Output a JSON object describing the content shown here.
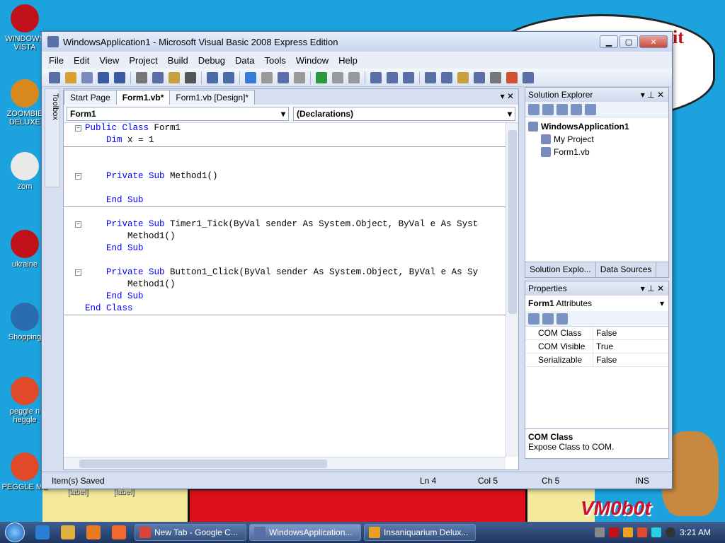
{
  "desktop": {
    "icons": [
      {
        "label": "WINDOWS VISTA",
        "color": "#c0101a"
      },
      {
        "label": "ZOOMBIE DELUXE",
        "color": "#d88a20"
      },
      {
        "label": "zom",
        "color": "#e9e9e9"
      },
      {
        "label": "ukraine",
        "color": "#c0101a"
      },
      {
        "label": "Shopping",
        "color": "#2b6cb0"
      },
      {
        "label": "peggle n heggle",
        "color": "#e04a2a"
      },
      {
        "label": "PEGGLE ME",
        "color": "#e04a2a"
      }
    ],
    "overlay_label_a": "[label]",
    "overlay_label_b": "[label]",
    "bubble_text": "it",
    "watermark": "VM0b0t"
  },
  "window": {
    "title": "WindowsApplication1 - Microsoft Visual Basic 2008 Express Edition",
    "min_label": "▁",
    "max_label": "▢",
    "close_label": "✕"
  },
  "menu": [
    "File",
    "Edit",
    "View",
    "Project",
    "Build",
    "Debug",
    "Data",
    "Tools",
    "Window",
    "Help"
  ],
  "toolbox_label": "Toolbox",
  "editor": {
    "tabs": [
      "Start Page",
      "Form1.vb*",
      "Form1.vb [Design]*"
    ],
    "active_tab": 1,
    "tab_ctrls": "▾  ✕",
    "class_combo": "Form1",
    "member_combo": "(Declarations)",
    "lines": [
      {
        "fold": "−",
        "kw": "Public Class",
        "text": " Form1",
        "sep": false
      },
      {
        "fold": "",
        "kw": "    Dim",
        "text": " x = 1",
        "sep": true
      },
      {
        "fold": "",
        "kw": "",
        "text": "",
        "sep": false
      },
      {
        "fold": "",
        "kw": "",
        "text": "",
        "sep": false
      },
      {
        "fold": "−",
        "kw": "    Private Sub",
        "text": " Method1()",
        "sep": false
      },
      {
        "fold": "",
        "kw": "",
        "text": "",
        "sep": false
      },
      {
        "fold": "",
        "kw": "    End Sub",
        "text": "",
        "sep": true
      },
      {
        "fold": "",
        "kw": "",
        "text": "",
        "sep": false
      },
      {
        "fold": "−",
        "kw": "    Private Sub",
        "text": " Timer1_Tick(ByVal sender As System.Object, ByVal e As Syst",
        "sep": false
      },
      {
        "fold": "",
        "kw": "",
        "text": "        Method1()",
        "sep": false
      },
      {
        "fold": "",
        "kw": "    End Sub",
        "text": "",
        "sep": false
      },
      {
        "fold": "",
        "kw": "",
        "text": "",
        "sep": false
      },
      {
        "fold": "−",
        "kw": "    Private Sub",
        "text": " Button1_Click(ByVal sender As System.Object, ByVal e As Sy",
        "sep": false
      },
      {
        "fold": "",
        "kw": "",
        "text": "        Method1()",
        "sep": false
      },
      {
        "fold": "",
        "kw": "    End Sub",
        "text": "",
        "sep": false
      },
      {
        "fold": "",
        "kw": "End Class",
        "text": "",
        "sep": true
      }
    ]
  },
  "solution_explorer": {
    "title": "Solution Explorer",
    "ctrls": "▾ ⊥ ✕",
    "items": [
      {
        "label": "WindowsApplication1",
        "indent": 0,
        "bold": true
      },
      {
        "label": "My Project",
        "indent": 1,
        "bold": false
      },
      {
        "label": "Form1.vb",
        "indent": 1,
        "bold": false
      }
    ],
    "bottom_tabs": [
      "Solution Explo...",
      "Data Sources"
    ]
  },
  "properties": {
    "title": "Properties",
    "ctrls": "▾ ⊥ ✕",
    "object": "Form1",
    "object_kind": "Attributes",
    "rows": [
      {
        "name": "COM Class",
        "value": "False"
      },
      {
        "name": "COM Visible",
        "value": "True"
      },
      {
        "name": "Serializable",
        "value": "False"
      }
    ],
    "desc_title": "COM Class",
    "desc_text": "Expose Class to COM."
  },
  "status": {
    "message": "Item(s) Saved",
    "ln": "Ln 4",
    "col": "Col 5",
    "ch": "Ch 5",
    "mode": "INS"
  },
  "taskbar": {
    "tasks": [
      {
        "label": "New Tab - Google C...",
        "color": "#db4437",
        "active": false
      },
      {
        "label": "WindowsApplication...",
        "color": "#5a6ea8",
        "active": true
      },
      {
        "label": "Insaniquarium Delux...",
        "color": "#e8a020",
        "active": false
      }
    ],
    "clock": "3:21 AM"
  }
}
